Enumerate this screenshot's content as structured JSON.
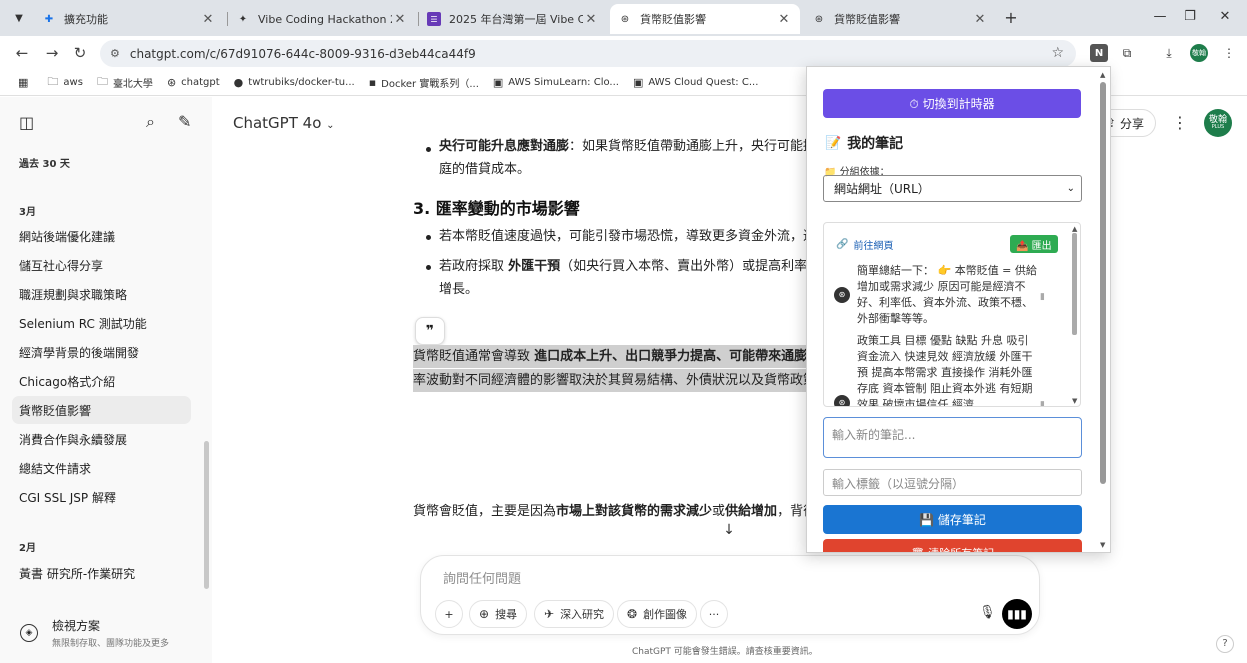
{
  "browser": {
    "tabs": [
      {
        "title": "擴充功能",
        "icon": "puzzle-icon",
        "active": false
      },
      {
        "title": "Vibe Coding Hackathon 2025 丨",
        "icon": "spark-icon",
        "active": false
      },
      {
        "title": "2025 年台灣第一屆 Vibe Coding",
        "icon": "form-icon",
        "active": false
      },
      {
        "title": "貨幣貶值影響",
        "icon": "chatgpt-icon",
        "active": true
      },
      {
        "title": "貨幣貶值影響",
        "icon": "chatgpt-icon",
        "active": false
      }
    ],
    "url": "chatgpt.com/c/67d91076-644c-8009-9316-d3eb44ca44f9",
    "bookmarks": [
      {
        "label": "aws",
        "icon": "folder-icon"
      },
      {
        "label": "臺北大學",
        "icon": "folder-icon"
      },
      {
        "label": "chatgpt",
        "icon": "chatgpt-icon"
      },
      {
        "label": "twtrubiks/docker-tu...",
        "icon": "github-icon"
      },
      {
        "label": "Docker 實戰系列（...",
        "icon": "docker-icon"
      },
      {
        "label": "AWS SimuLearn: Clo...",
        "icon": "aws-icon"
      },
      {
        "label": "AWS Cloud Quest: C...",
        "icon": "aws-icon"
      }
    ],
    "profile_initial": "敬翰"
  },
  "sidebar": {
    "section_recent": "過去 30 天",
    "section_march": "3月",
    "march_items": [
      "網站後端優化建議",
      "儲互社心得分享",
      "職涯規劃與求職策略",
      "Selenium RC 測試功能",
      "經濟學背景的後端開發",
      "Chicago格式介紹",
      "貨幣貶值影響",
      "消費合作與永續發展",
      "總結文件請求",
      "CGI SSL JSP 解釋"
    ],
    "section_feb": "2月",
    "feb_items": [
      "黃書 研究所-作業研究"
    ],
    "upgrade_title": "檢視方案",
    "upgrade_sub": "無限制存取、團隊功能及更多"
  },
  "main": {
    "model": "ChatGPT 4o",
    "share": "分享",
    "avatar_text": "敬翰",
    "avatar_plus": "PLUS",
    "line1_bold": "央行可能升息應對通膨",
    "line1_rest": "：如果貨幣貶值帶動通膨上升，央行可能提",
    "line2": "庭的借貸成本。",
    "heading": "3. 匯率變動的市場影響",
    "bullet1": "若本幣貶值速度過快，可能引發市場恐慌，導致更多資金外流，造",
    "bullet2_pre": "若政府採取 ",
    "bullet2_bold": "外匯干預",
    "bullet2_rest": "（如央行買入本幣、賣出外幣）或提高利率",
    "bullet2_cont": "增長。",
    "summary_pre": "貨幣貶值通常會導致 ",
    "summary_bold": "進口成本上升、出口競爭力提高、可能帶來通膨",
    "summary_line2": "率波動對不同經濟體的影響取決於其貿易結構、外債狀況以及貨幣政策",
    "answer_pre": "貨幣會貶值，主要是因為",
    "answer_bold1": "市場上對該貨幣的需求減少",
    "answer_mid": "或",
    "answer_bold2": "供給增加",
    "answer_rest": "，背後",
    "composer_placeholder": "詢問任何問題",
    "btn_search": "搜尋",
    "btn_research": "深入研究",
    "btn_image": "創作圖像",
    "disclaimer": "ChatGPT 可能會發生錯誤。請查核重要資訊。"
  },
  "extension": {
    "timer_button": "⏱ 切換到計時器",
    "notes_title": "我的筆記",
    "group_label": "📁 分組依據：",
    "group_value": "網站網址（URL）",
    "goto_link": "前往網頁",
    "export_button": "📤 匯出",
    "notes": [
      "簡單總結一下： 👉 本幣貶值 = 供給增加或需求減少 原因可能是經濟不好、利率低、資本外流、政策不穩、外部衝擊等等。",
      "政策工具 目標 優點 缺點 升息 吸引資金流入 快速見效 經濟放緩 外匯干預 提高本幣需求 直接操作 消耗外匯存底 資本管制 阻止資本外逃 有短期效果 破壞市場信任 經濟"
    ],
    "new_note_placeholder": "輸入新的筆記...",
    "tag_placeholder": "輸入標籤（以逗號分隔）",
    "save_button": "💾 儲存筆記",
    "clear_button": "🗑 清除所有筆記"
  }
}
